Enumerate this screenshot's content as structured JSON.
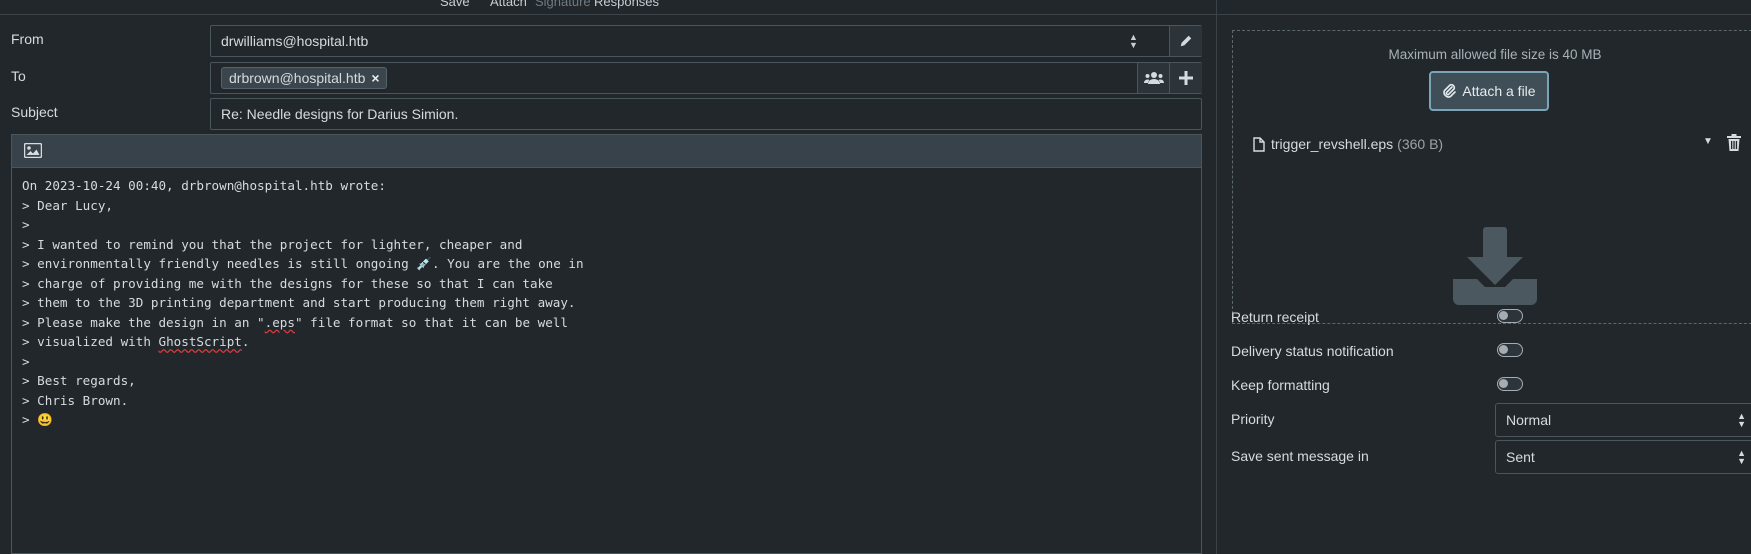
{
  "toolbar": {
    "save": "Save",
    "attach": "Attach",
    "signature": "Signature",
    "responses": "Responses"
  },
  "compose": {
    "from_label": "From",
    "from_value": "drwilliams@hospital.htb",
    "to_label": "To",
    "to_recipient": "drbrown@hospital.htb",
    "subject_label": "Subject",
    "subject_value": "Re: Needle designs for Darius Simion.",
    "body_lines": [
      "On 2023-10-24 00:40, drbrown@hospital.htb wrote:",
      "> Dear Lucy,",
      ">",
      "> I wanted to remind you that the project for lighter, cheaper and",
      "> environmentally friendly needles is still ongoing 💉. You are the one in",
      "> charge of providing me with the designs for these so that I can take",
      "> them to the 3D printing department and start producing them right away.",
      "> Please make the design in an \".eps\" file format so that it can be well",
      "> visualized with GhostScript.",
      ">",
      "> Best regards,",
      "> Chris Brown.",
      "> 😃"
    ]
  },
  "attachments": {
    "max_size_text": "Maximum allowed file size is 40 MB",
    "attach_button": "Attach a file",
    "file_name": "trigger_revshell.eps",
    "file_size": "(360 B)"
  },
  "options": {
    "return_receipt": "Return receipt",
    "return_receipt_on": false,
    "delivery_status": "Delivery status notification",
    "delivery_status_on": false,
    "keep_formatting": "Keep formatting",
    "keep_formatting_on": false,
    "priority_label": "Priority",
    "priority_value": "Normal",
    "save_sent_label": "Save sent message in",
    "save_sent_value": "Sent"
  },
  "colors": {
    "background": "#21272b",
    "accent": "#7aa4b8",
    "spellcheck": "#d63c3c"
  },
  "icons": [
    "pencil-icon",
    "address-book-icon",
    "plus-icon",
    "image-icon",
    "paperclip-icon",
    "file-icon",
    "chevron-down-icon",
    "trash-icon",
    "download-icon"
  ]
}
